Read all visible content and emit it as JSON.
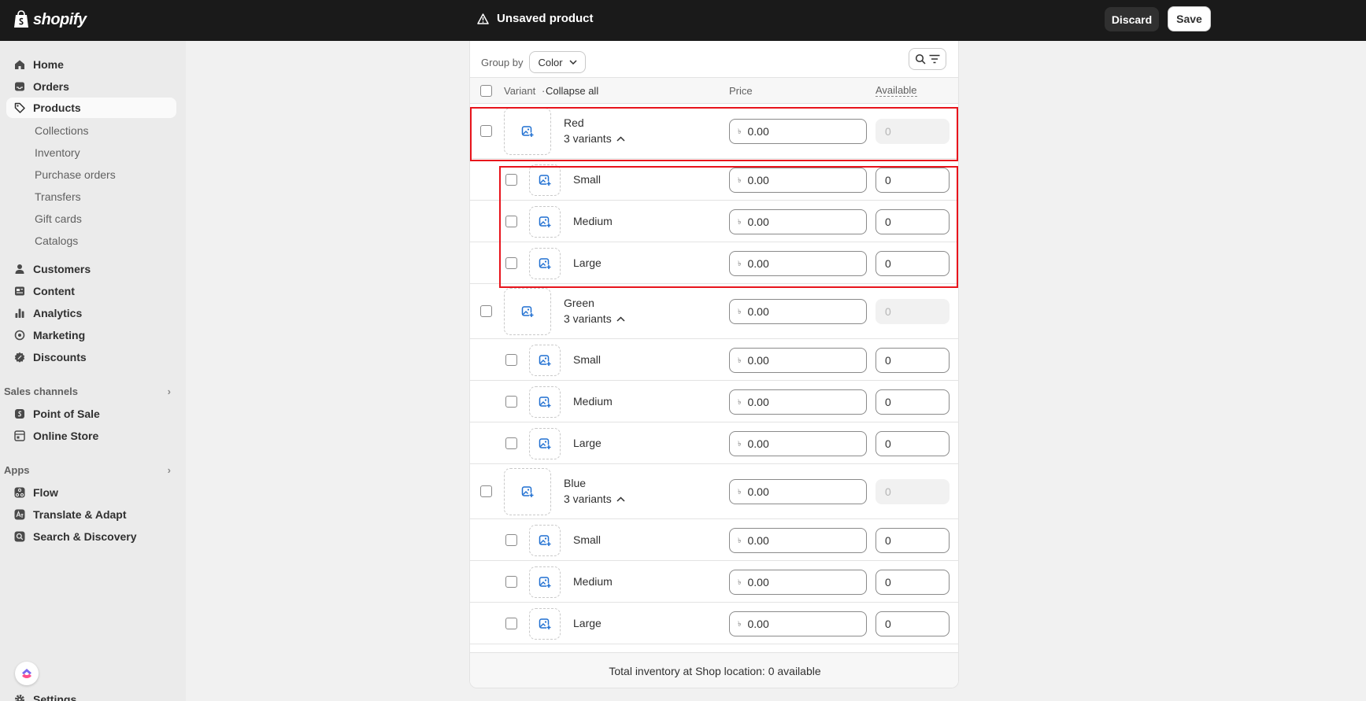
{
  "topbar": {
    "logo_text": "shopify",
    "status_text": "Unsaved product",
    "discard_label": "Discard",
    "save_label": "Save"
  },
  "sidebar": {
    "main_items": [
      {
        "label": "Home",
        "icon": "home-icon"
      },
      {
        "label": "Orders",
        "icon": "inbox-icon"
      },
      {
        "label": "Products",
        "icon": "tag-icon",
        "active": true
      }
    ],
    "product_subitems": [
      "Collections",
      "Inventory",
      "Purchase orders",
      "Transfers",
      "Gift cards",
      "Catalogs"
    ],
    "secondary_items": [
      {
        "label": "Customers",
        "icon": "person-icon"
      },
      {
        "label": "Content",
        "icon": "content-icon"
      },
      {
        "label": "Analytics",
        "icon": "bar-chart-icon"
      },
      {
        "label": "Marketing",
        "icon": "target-icon"
      },
      {
        "label": "Discounts",
        "icon": "discount-icon"
      }
    ],
    "sales_channels_title": "Sales channels",
    "sales_channels": [
      {
        "label": "Point of Sale",
        "icon": "pos-icon"
      },
      {
        "label": "Online Store",
        "icon": "store-icon"
      }
    ],
    "apps_title": "Apps",
    "apps": [
      {
        "label": "Flow",
        "icon": "flow-icon"
      },
      {
        "label": "Translate & Adapt",
        "icon": "translate-icon"
      },
      {
        "label": "Search & Discovery",
        "icon": "search-discovery-icon"
      }
    ],
    "settings_label": "Settings"
  },
  "variants_card": {
    "group_by_label": "Group by",
    "group_by_value": "Color",
    "header": {
      "variant": "Variant",
      "collapse_all": "Collapse all",
      "separator": "·",
      "price": "Price",
      "available": "Available"
    },
    "currency_symbol": "৳",
    "groups": [
      {
        "name": "Red",
        "count_label": "3 variants",
        "price": "0.00",
        "available": "0",
        "variants": [
          {
            "name": "Small",
            "price": "0.00",
            "available": "0"
          },
          {
            "name": "Medium",
            "price": "0.00",
            "available": "0"
          },
          {
            "name": "Large",
            "price": "0.00",
            "available": "0"
          }
        ]
      },
      {
        "name": "Green",
        "count_label": "3 variants",
        "price": "0.00",
        "available": "0",
        "variants": [
          {
            "name": "Small",
            "price": "0.00",
            "available": "0"
          },
          {
            "name": "Medium",
            "price": "0.00",
            "available": "0"
          },
          {
            "name": "Large",
            "price": "0.00",
            "available": "0"
          }
        ]
      },
      {
        "name": "Blue",
        "count_label": "3 variants",
        "price": "0.00",
        "available": "0",
        "variants": [
          {
            "name": "Small",
            "price": "0.00",
            "available": "0"
          },
          {
            "name": "Medium",
            "price": "0.00",
            "available": "0"
          },
          {
            "name": "Large",
            "price": "0.00",
            "available": "0"
          }
        ]
      }
    ],
    "total_label": "Total inventory at Shop location: 0 available"
  },
  "colors": {
    "topbar_bg": "#1a1a1a",
    "sidebar_bg": "#ebebeb",
    "highlight": "#e8141c",
    "image_icon": "#1f6fd1"
  }
}
